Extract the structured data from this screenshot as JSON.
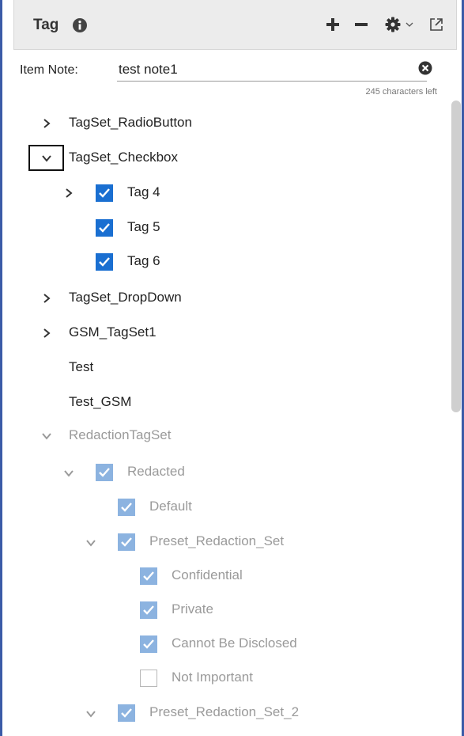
{
  "panel": {
    "title": "Tag",
    "icons": [
      "info-icon",
      "plus-icon",
      "minus-icon",
      "gear-icon",
      "chevron-down-icon",
      "popout-icon"
    ]
  },
  "note": {
    "label": "Item Note:",
    "value": "test note1",
    "chars_left": "245 characters left"
  },
  "tree": {
    "tagset_radio": "TagSet_RadioButton",
    "tagset_checkbox": "TagSet_Checkbox",
    "tag4": "Tag 4",
    "tag5": "Tag 5",
    "tag6": "Tag 6",
    "tagset_dropdown": "TagSet_DropDown",
    "gsm_tagset1": "GSM_TagSet1",
    "test": "Test",
    "test_gsm": "Test_GSM",
    "redaction_tagset": "RedactionTagSet",
    "redacted": "Redacted",
    "default": "Default",
    "preset_set": "Preset_Redaction_Set",
    "confidential": "Confidential",
    "private": "Private",
    "cannot_disclose": "Cannot Be Disclosed",
    "not_important": "Not Important",
    "preset_set_2": "Preset_Redaction_Set_2"
  },
  "colors": {
    "accent": "#1a6fd1",
    "accent_disabled": "#8cb3e0",
    "frame_border": "#3b5ba7"
  }
}
